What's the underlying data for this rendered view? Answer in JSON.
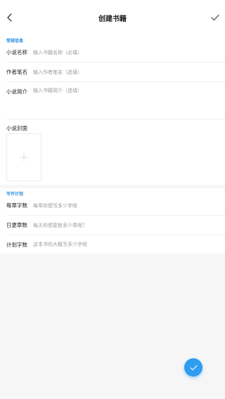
{
  "header": {
    "title": "创建书籍",
    "back_icon": "chevron-left-icon",
    "confirm_icon": "check-icon"
  },
  "general": {
    "section_title": "常规信息",
    "fields": [
      {
        "label": "小说名称",
        "placeholder": "输入书籍名称（必填）"
      },
      {
        "label": "作者笔名",
        "placeholder": "输入作者笔名（选填）"
      },
      {
        "label": "小说简介",
        "placeholder": "输入书籍简介（选填）"
      }
    ],
    "cover_label": "小说封面",
    "cover_icon": "plus-icon"
  },
  "plan": {
    "section_title": "写作计划",
    "fields": [
      {
        "label": "每章字数",
        "placeholder": "每章你想写多少字呢"
      },
      {
        "label": "日更章数",
        "placeholder": "每天你想更新多少章呢？"
      },
      {
        "label": "计划字数",
        "placeholder": "这本书你大概写多少字呢"
      }
    ]
  },
  "fab": {
    "icon": "check-icon"
  },
  "colors": {
    "accent": "#2f9cf0",
    "section_title": "#2a8ee0",
    "placeholder": "#9b9b9b",
    "background": "#f6f6f6"
  }
}
